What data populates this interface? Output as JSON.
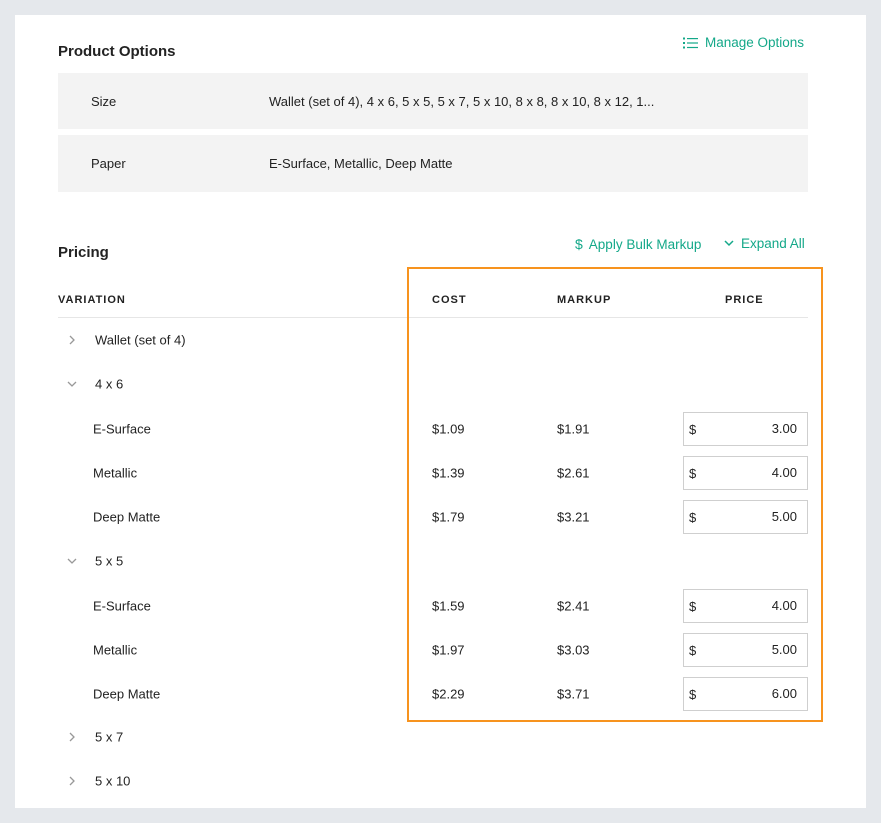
{
  "product_options": {
    "title": "Product Options",
    "manage_label": "Manage Options",
    "rows": [
      {
        "label": "Size",
        "value": "Wallet (set of 4), 4 x 6, 5 x 5, 5 x 7, 5 x 10, 8 x 8, 8 x 10, 8 x 12, 1..."
      },
      {
        "label": "Paper",
        "value": "E-Surface, Metallic, Deep Matte"
      }
    ]
  },
  "pricing": {
    "title": "Pricing",
    "bulk_markup_label": "Apply Bulk Markup",
    "expand_all_label": "Expand All",
    "columns": {
      "variation": "VARIATION",
      "cost": "COST",
      "markup": "MARKUP",
      "price": "PRICE"
    },
    "currency": "$",
    "rows": [
      {
        "type": "group",
        "label": "Wallet (set of 4)",
        "expanded": false
      },
      {
        "type": "group",
        "label": "4 x 6",
        "expanded": true
      },
      {
        "type": "item",
        "label": "E-Surface",
        "cost": "$1.09",
        "markup": "$1.91",
        "price": "3.00"
      },
      {
        "type": "item",
        "label": "Metallic",
        "cost": "$1.39",
        "markup": "$2.61",
        "price": "4.00"
      },
      {
        "type": "item",
        "label": "Deep Matte",
        "cost": "$1.79",
        "markup": "$3.21",
        "price": "5.00"
      },
      {
        "type": "group",
        "label": "5 x 5",
        "expanded": true
      },
      {
        "type": "item",
        "label": "E-Surface",
        "cost": "$1.59",
        "markup": "$2.41",
        "price": "4.00"
      },
      {
        "type": "item",
        "label": "Metallic",
        "cost": "$1.97",
        "markup": "$3.03",
        "price": "5.00"
      },
      {
        "type": "item",
        "label": "Deep Matte",
        "cost": "$2.29",
        "markup": "$3.71",
        "price": "6.00"
      },
      {
        "type": "group",
        "label": "5 x 7",
        "expanded": false
      },
      {
        "type": "group",
        "label": "5 x 10",
        "expanded": false
      }
    ]
  },
  "colors": {
    "accent": "#14a889",
    "highlight": "#f7931e"
  }
}
